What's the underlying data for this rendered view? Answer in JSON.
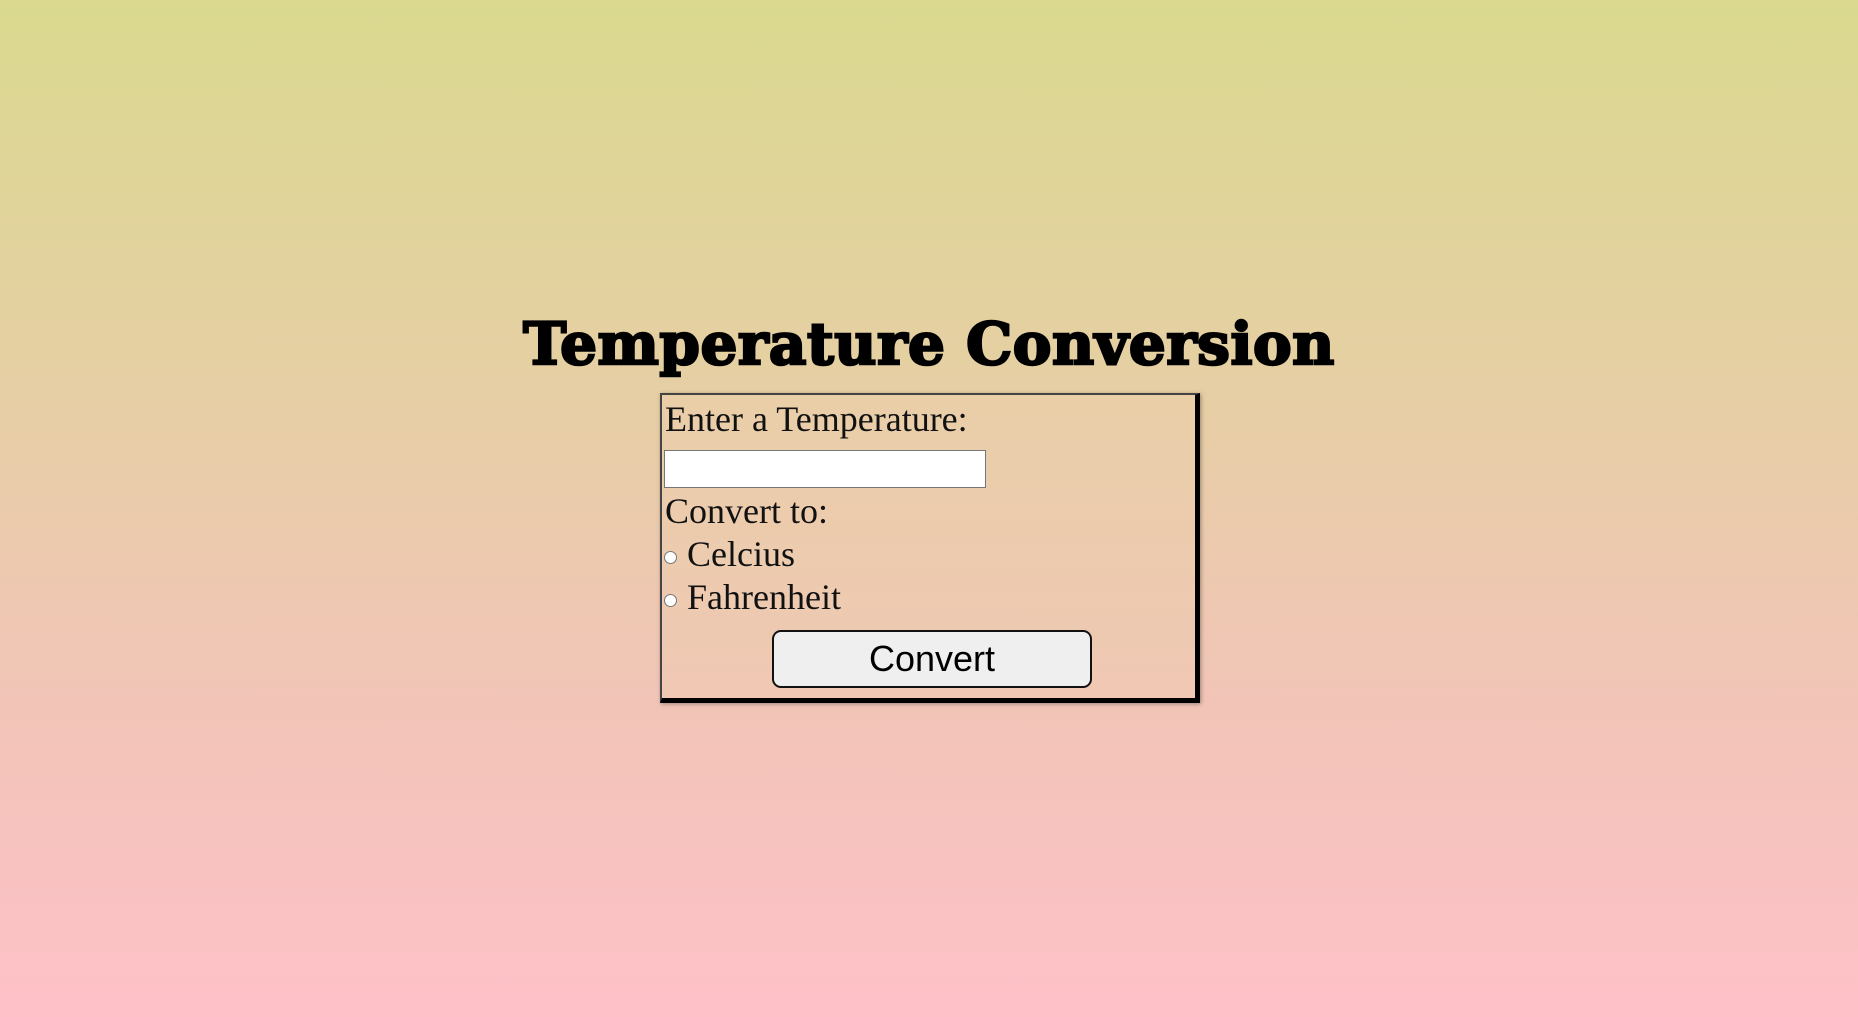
{
  "page": {
    "title": "Temperature Conversion"
  },
  "form": {
    "enter_label": "Enter a Temperature:",
    "temperature_input": {
      "value": "",
      "placeholder": ""
    },
    "convert_to_label": "Convert to:",
    "options": [
      {
        "label": "Celcius",
        "selected": false
      },
      {
        "label": "Fahrenheit",
        "selected": false
      }
    ],
    "convert_button_label": "Convert"
  },
  "colors": {
    "background_top": "#dad98f",
    "background_bottom": "#fec1c8",
    "box_border": "#000000",
    "button_background": "#efefef"
  }
}
